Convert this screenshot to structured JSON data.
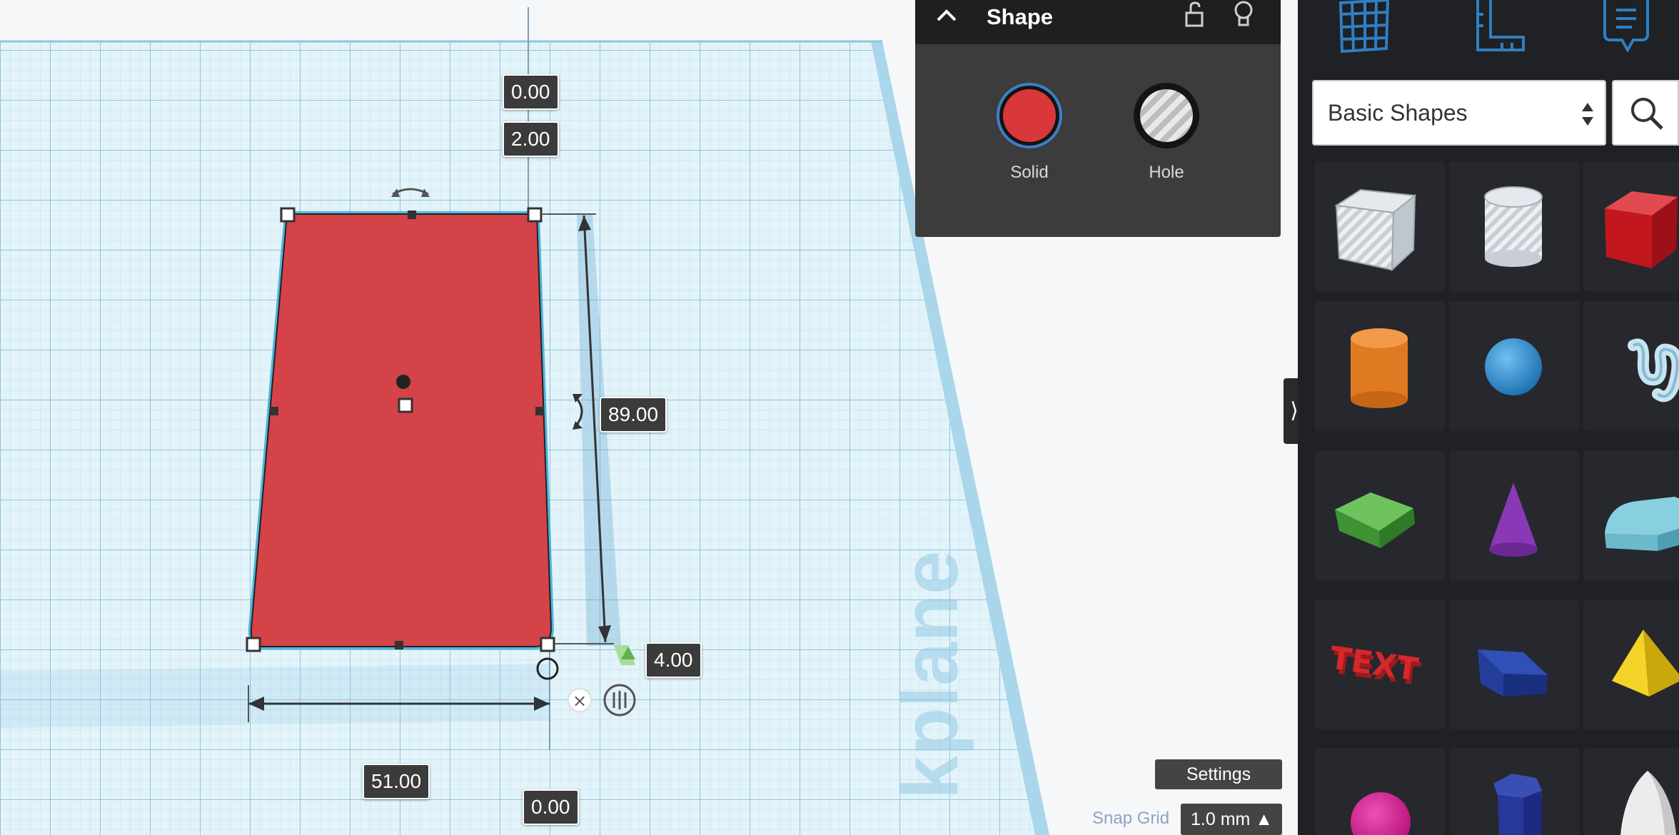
{
  "shape_panel": {
    "title": "Shape",
    "solid_label": "Solid",
    "hole_label": "Hole",
    "solid_color": "#d9383a"
  },
  "dimensions": {
    "elevation": "0.00",
    "height": "2.00",
    "length": "89.00",
    "corner": "4.00",
    "width": "51.00",
    "bottom_offset": "0.00"
  },
  "workplane": {
    "label": "kplane"
  },
  "footer": {
    "settings_label": "Settings",
    "snap_grid_label": "Snap Grid",
    "snap_grid_value": "1.0 mm ▲"
  },
  "library": {
    "category": "Basic Shapes",
    "shapes": [
      {
        "name": "Box (Hole)",
        "icon": "hole-box-icon"
      },
      {
        "name": "Cylinder (Hole)",
        "icon": "hole-cylinder-icon"
      },
      {
        "name": "Box",
        "icon": "box-icon",
        "color": "#d01f27"
      },
      {
        "name": "Cylinder",
        "icon": "cylinder-icon",
        "color": "#e27828"
      },
      {
        "name": "Sphere",
        "icon": "sphere-icon",
        "color": "#2d8fd5"
      },
      {
        "name": "Scribble",
        "icon": "scribble-icon",
        "color": "#a7d1e6"
      },
      {
        "name": "Roof",
        "icon": "roof-icon",
        "color": "#4ca843"
      },
      {
        "name": "Cone",
        "icon": "cone-icon",
        "color": "#8c3bb8"
      },
      {
        "name": "Round Roof",
        "icon": "round-roof-icon",
        "color": "#79c3d6"
      },
      {
        "name": "Text",
        "icon": "text-icon",
        "color": "#d0292a"
      },
      {
        "name": "Wedge",
        "icon": "wedge-icon",
        "color": "#1f3ca3"
      },
      {
        "name": "Pyramid",
        "icon": "pyramid-icon",
        "color": "#f1cd18"
      },
      {
        "name": "Half Sphere",
        "icon": "half-sphere-icon",
        "color": "#d0188e"
      },
      {
        "name": "Polygon",
        "icon": "polygon-icon",
        "color": "#25389e"
      },
      {
        "name": "Paraboloid",
        "icon": "paraboloid-icon",
        "color": "#e6e6e6"
      }
    ]
  }
}
